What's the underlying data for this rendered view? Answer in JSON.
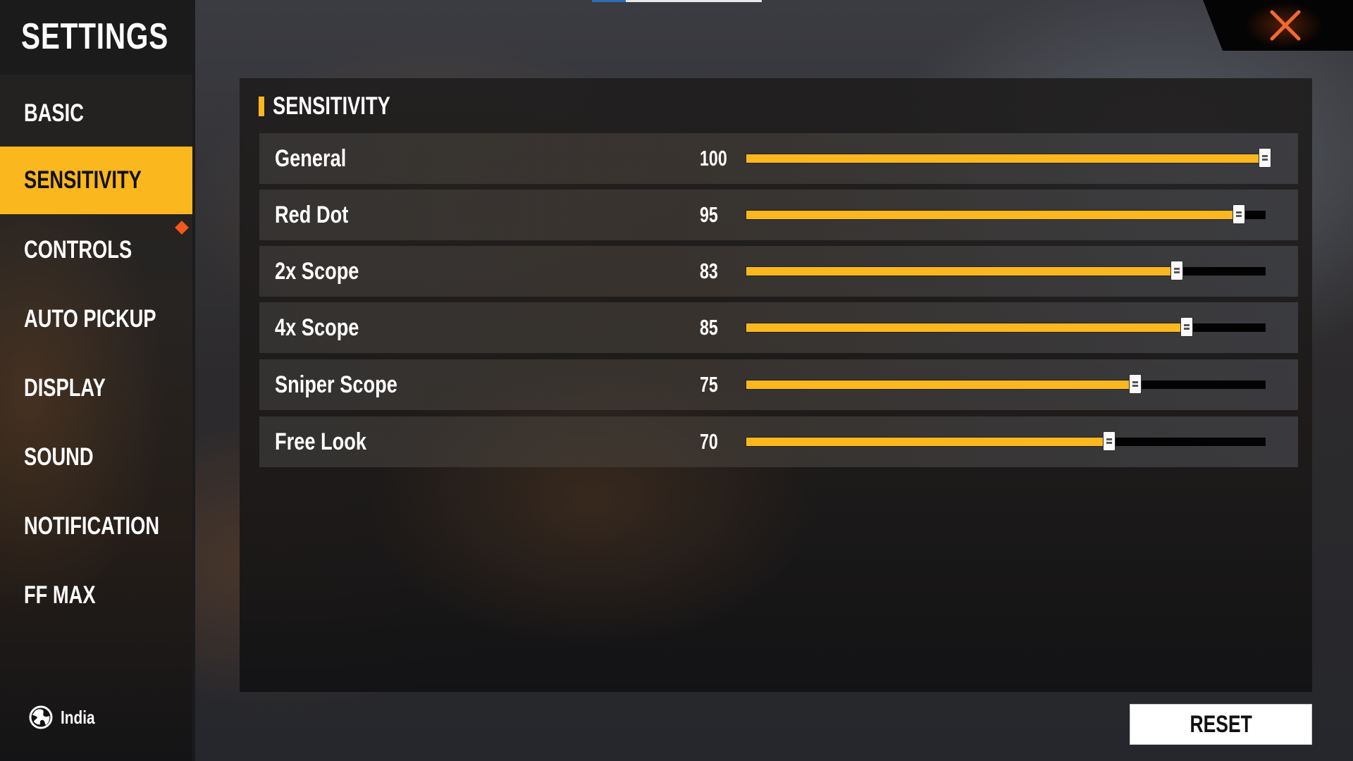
{
  "title": "SETTINGS",
  "sidebar": {
    "items": [
      {
        "label": "BASIC",
        "active": false
      },
      {
        "label": "SENSITIVITY",
        "active": true
      },
      {
        "label": "CONTROLS",
        "active": false,
        "notification": true
      },
      {
        "label": "AUTO PICKUP",
        "active": false
      },
      {
        "label": "DISPLAY",
        "active": false
      },
      {
        "label": "SOUND",
        "active": false
      },
      {
        "label": "NOTIFICATION",
        "active": false
      },
      {
        "label": "FF MAX",
        "active": false
      }
    ],
    "region": {
      "icon": "globe-icon",
      "label": "India"
    }
  },
  "close": {
    "icon": "close-icon"
  },
  "section": {
    "title": "SENSITIVITY"
  },
  "sensitivity": [
    {
      "label": "General",
      "value": 100
    },
    {
      "label": "Red Dot",
      "value": 95
    },
    {
      "label": "2x Scope",
      "value": 83
    },
    {
      "label": "4x Scope",
      "value": 85
    },
    {
      "label": "Sniper Scope",
      "value": 75
    },
    {
      "label": "Free Look",
      "value": 70
    }
  ],
  "slider_range": [
    0,
    100
  ],
  "reset_label": "RESET",
  "colors": {
    "accent": "#fbb71e",
    "close": "#f26a2e",
    "notification": "#f2591b",
    "track": "#030303"
  }
}
